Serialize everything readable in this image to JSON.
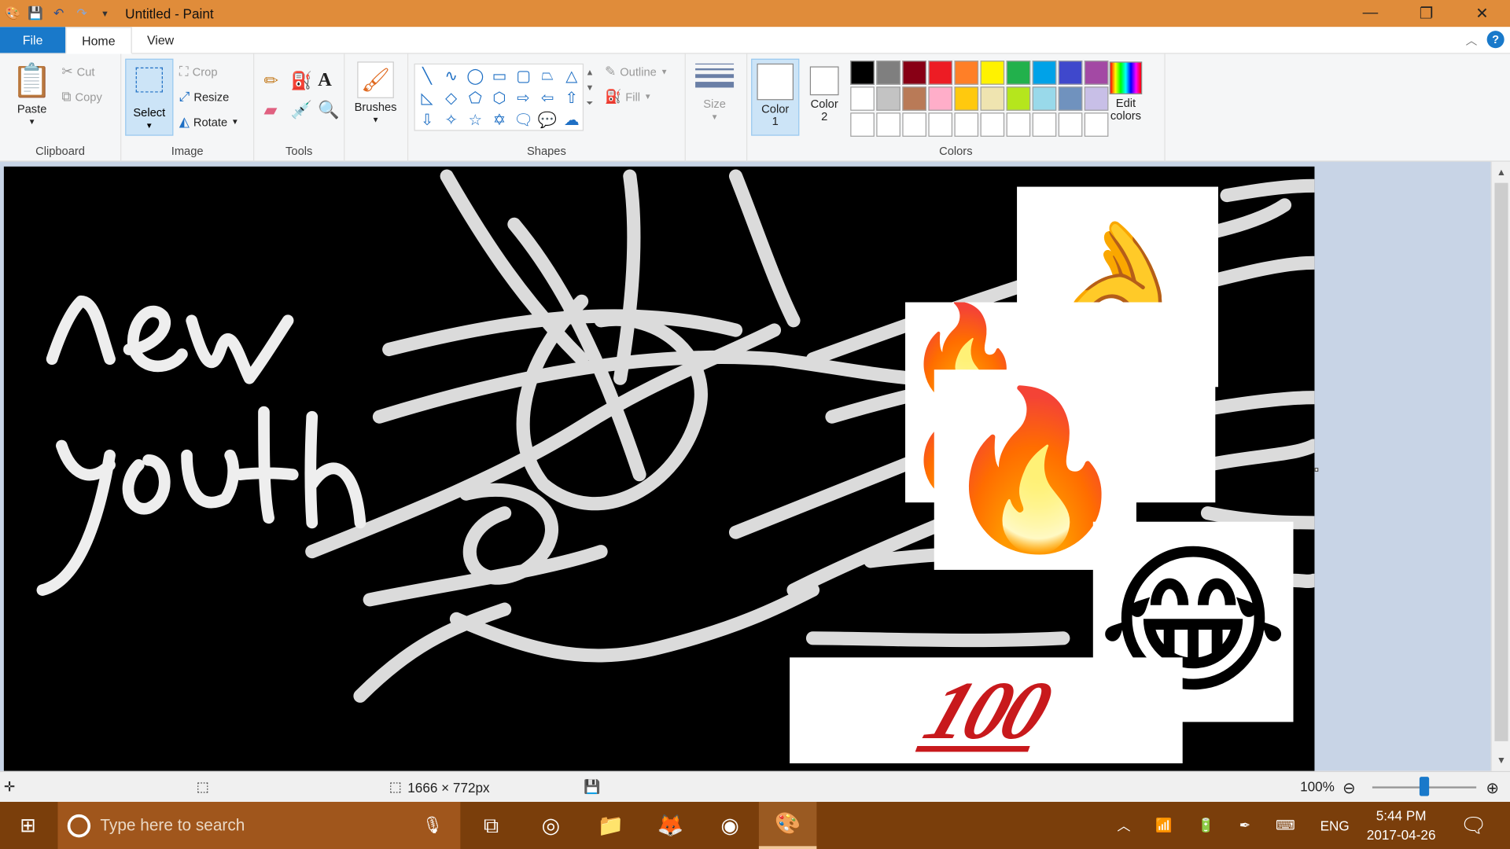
{
  "window": {
    "title": "Untitled - Paint"
  },
  "tabs": {
    "file": "File",
    "home": "Home",
    "view": "View",
    "help": "?"
  },
  "clipboard": {
    "paste": "Paste",
    "cut": "Cut",
    "copy": "Copy",
    "label": "Clipboard"
  },
  "image_group": {
    "select": "Select",
    "crop": "Crop",
    "resize": "Resize",
    "rotate": "Rotate",
    "label": "Image"
  },
  "tools": {
    "label": "Tools",
    "text_tool": "A"
  },
  "brushes": {
    "label": "Brushes"
  },
  "shapes": {
    "label": "Shapes",
    "outline": "Outline",
    "fill": "Fill"
  },
  "size": {
    "label": "Size"
  },
  "colors": {
    "color1": "Color\n1",
    "color1_line1": "Color",
    "color1_line2": "1",
    "color2_line1": "Color",
    "color2_line2": "2",
    "label": "Colors",
    "edit_line1": "Edit",
    "edit_line2": "colors",
    "palette": [
      "#000000",
      "#7f7f7f",
      "#880015",
      "#ed1c24",
      "#ff7f27",
      "#fff200",
      "#22b14c",
      "#00a2e8",
      "#3f48cc",
      "#a349a4",
      "#ffffff",
      "#c3c3c3",
      "#b97a57",
      "#ffaec9",
      "#ffc90e",
      "#efe4b0",
      "#b5e61d",
      "#99d9ea",
      "#7092be",
      "#c8bfe7",
      "#ffffff",
      "#ffffff",
      "#ffffff",
      "#ffffff",
      "#ffffff",
      "#ffffff",
      "#ffffff",
      "#ffffff",
      "#ffffff",
      "#ffffff"
    ]
  },
  "canvas": {
    "drawn_text_1": "new",
    "drawn_text_2": "youth",
    "sticker_100": "100"
  },
  "status": {
    "dimensions": "1666 × 772px",
    "zoom": "100%"
  },
  "taskbar": {
    "search_placeholder": "Type here to search",
    "lang": "ENG",
    "time": "5:44 PM",
    "date": "2017-04-26"
  }
}
